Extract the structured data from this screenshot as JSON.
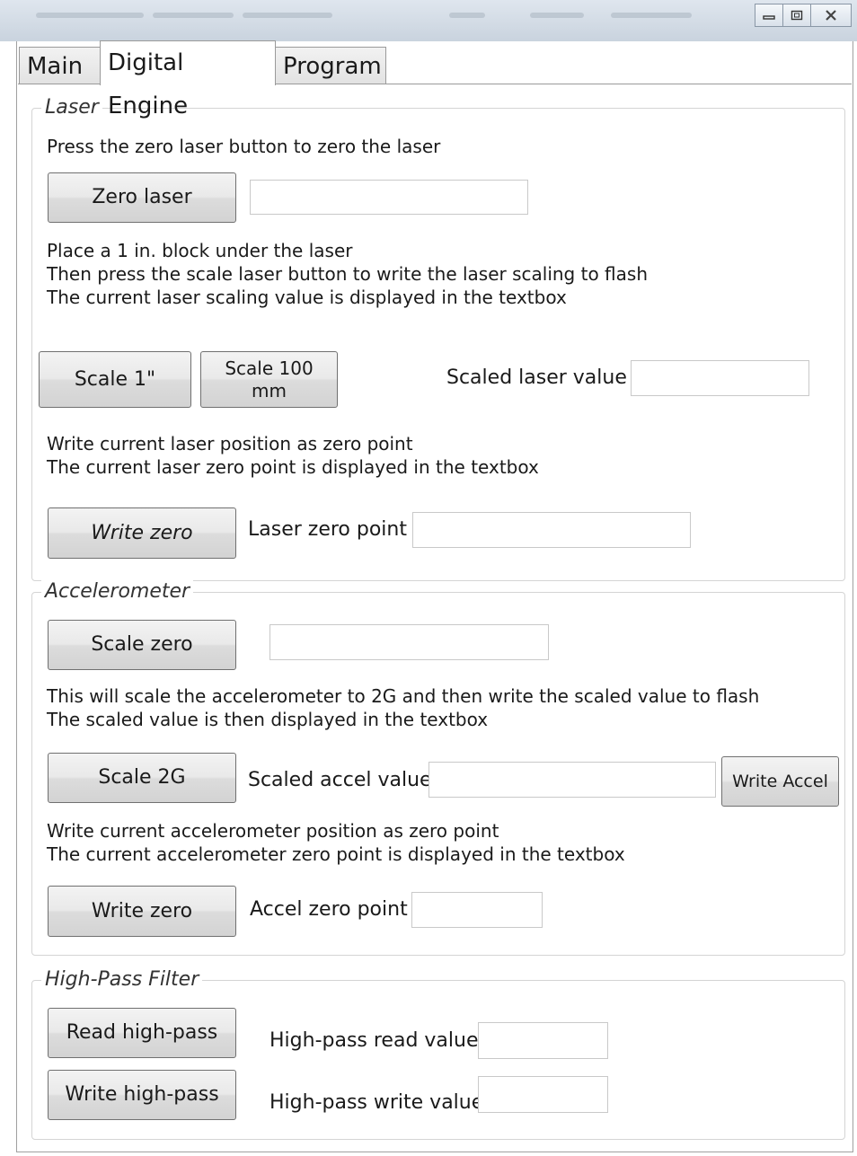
{
  "window": {
    "controls": {
      "minimize": "minimize-icon",
      "maximize": "maximize-icon",
      "close": "close-icon"
    }
  },
  "tabs": [
    {
      "label": "Main"
    },
    {
      "label": "Digital Engine"
    },
    {
      "label": "Program"
    }
  ],
  "laser": {
    "legend": "Laser",
    "zero_instructions": "Press the zero laser button to zero the laser",
    "zero_button": "Zero laser",
    "scale_instructions": "Place a 1 in. block under the laser\nThen press the scale laser button to write the laser scaling to flash\nThe current laser scaling value is displayed in the textbox",
    "scale_1in_button": "Scale 1\"",
    "scale_100mm_button": "Scale 100\nmm",
    "scaled_value_label": "Scaled laser value",
    "write_zero_instructions": "Write current laser position as zero point\nThe current laser zero point is displayed in the textbox",
    "write_zero_button": "Write zero",
    "zero_point_label": "Laser zero point"
  },
  "accelerometer": {
    "legend": "Accelerometer",
    "scale_zero_button": "Scale zero",
    "scale_instructions": "This will scale the accelerometer to 2G and then write the scaled value to flash\nThe scaled value is then displayed in the textbox",
    "scale_2g_button": "Scale 2G",
    "scaled_value_label": "Scaled accel value",
    "write_accel_button": "Write Accel",
    "write_zero_instructions": "Write current accelerometer position as zero point\nThe current accelerometer zero point is displayed in the textbox",
    "write_zero_button": "Write zero",
    "zero_point_label": "Accel zero point"
  },
  "high_pass": {
    "legend": "High-Pass Filter",
    "read_button": "Read high-pass",
    "read_label": "High-pass read value",
    "write_button": "Write high-pass",
    "write_label": "High-pass write value"
  }
}
